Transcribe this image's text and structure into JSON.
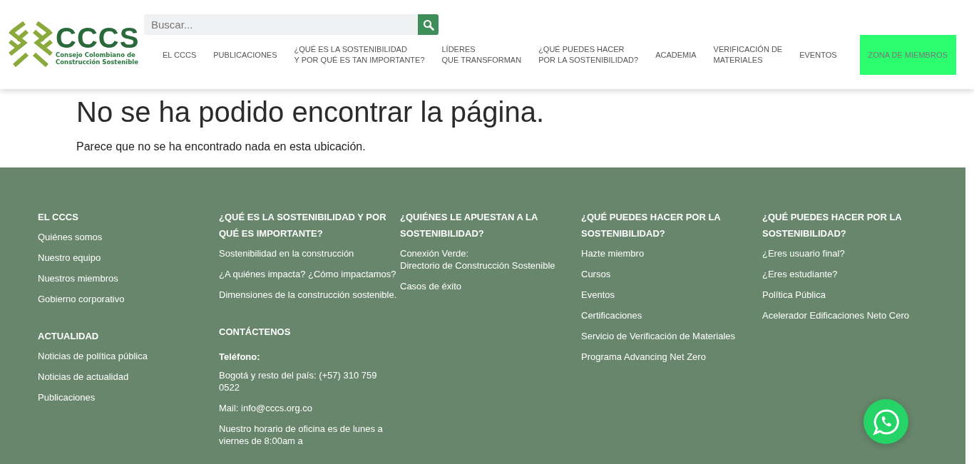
{
  "header": {
    "logo": {
      "wordmark": "CCCS",
      "subtitle": "Consejo Colombiano de\nConstrucción Sostenible"
    },
    "search": {
      "placeholder": "Buscar..."
    },
    "nav": [
      {
        "label": "EL CCCS",
        "kind": "link"
      },
      {
        "label": "PUBLICACIONES",
        "kind": "link"
      },
      {
        "label": "¿QUÉ ES LA SOSTENIBILIDAD\nY POR QUÉ ES TAN IMPORTANTE?",
        "kind": "link"
      },
      {
        "label": "LÍDERES\nQUE TRANSFORMAN",
        "kind": "link"
      },
      {
        "label": "¿QUÉ PUEDES HACER\nPOR LA SOSTENIBILIDAD?",
        "kind": "link"
      },
      {
        "label": "ACADEMIA",
        "kind": "link"
      },
      {
        "label": "VERIFICACIÓN DE\nMATERIALES",
        "kind": "link"
      },
      {
        "label": "EVENTOS",
        "kind": "link"
      },
      {
        "label": "ZONA DE MIEMBROS",
        "kind": "button"
      }
    ]
  },
  "main": {
    "title": "No se ha podido encontrar la página.",
    "message": "Parece que no se ha encontrado nada en esta ubicación."
  },
  "footer": {
    "columns": [
      {
        "sections": [
          {
            "heading": "EL CCCS",
            "items": [
              "Quiénes somos",
              "Nuestro equipo",
              "Nuestros miembros",
              "Gobierno corporativo"
            ]
          },
          {
            "heading": "ACTUALIDAD",
            "items": [
              "Noticias de política pública",
              "Noticias de actualidad",
              "Publicaciones"
            ]
          }
        ]
      },
      {
        "sections": [
          {
            "heading": "¿QUÉ ES LA SOSTENIBILIDAD Y POR QUÉ ES IMPORTANTE?",
            "items": [
              "Sostenibilidad en la construcción",
              "¿A quiénes impacta? ¿Cómo impactamos?",
              "Dimensiones de la construcción sostenible."
            ]
          },
          {
            "heading": "CONTÁCTENOS",
            "subheading": "Teléfono:",
            "items": [
              "Bogotá y resto del país: (+57) 310 759 0522",
              "Mail: info@cccs.org.co",
              "Nuestro horario de oficina es de lunes a viernes de 8:00am a"
            ]
          }
        ]
      },
      {
        "sections": [
          {
            "heading": "¿QUIÉNES LE APUESTAN A LA SOSTENIBILIDAD?",
            "items": [
              "Conexión Verde:\nDirectorio de Construcción Sostenible",
              "Casos de éxito"
            ]
          }
        ]
      },
      {
        "sections": [
          {
            "heading": "¿QUÉ PUEDES HACER POR LA SOSTENIBILIDAD?",
            "items": [
              "Hazte miembro",
              "Cursos",
              "Eventos",
              "Certificaciones",
              "Servicio de Verificación de Materiales",
              "Programa Advancing Net Zero"
            ]
          }
        ]
      },
      {
        "sections": [
          {
            "heading": "¿QUÉ PUEDES HACER POR LA SOSTENIBILIDAD?",
            "items": [
              "¿Eres usuario final?",
              "¿Eres estudiante?",
              "Política Pública",
              "Acelerador Edificaciones Neto Cero"
            ]
          }
        ]
      }
    ]
  }
}
